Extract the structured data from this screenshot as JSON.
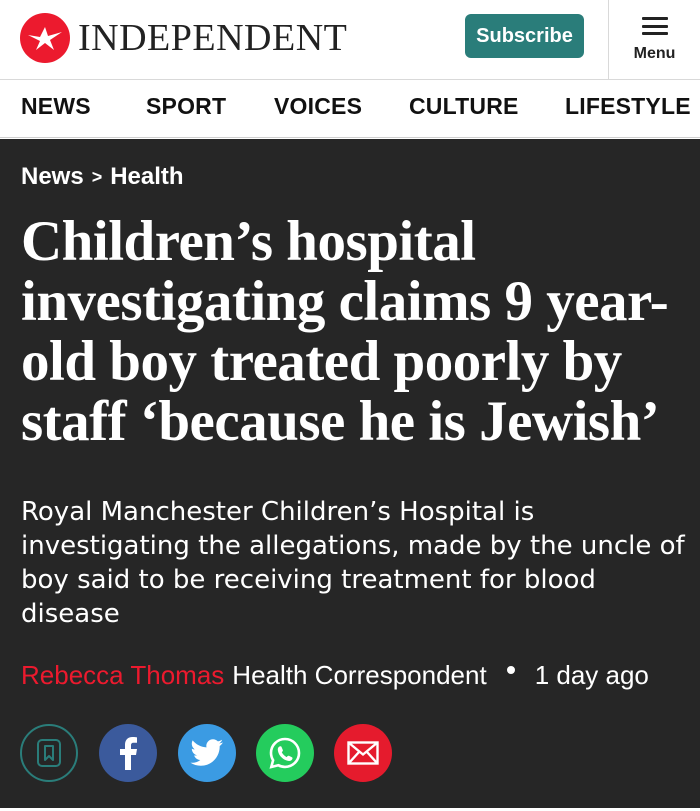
{
  "header": {
    "brand": "INDEPENDENT",
    "subscribe_label": "Subscribe",
    "menu_label": "Menu"
  },
  "nav": {
    "items": [
      {
        "label": "NEWS"
      },
      {
        "label": "SPORT"
      },
      {
        "label": "VOICES"
      },
      {
        "label": "CULTURE"
      },
      {
        "label": "LIFESTYLE"
      }
    ]
  },
  "article": {
    "breadcrumb": {
      "section": "News",
      "separator": ">",
      "subsection": "Health"
    },
    "headline": "Children’s hospital investigating claims 9 year-old boy treated poorly by staff ‘because he is Jewish’",
    "standfirst": "Royal Manchester Children’s Hospital is investigating the allegations, made by the uncle of boy said to be receiving treatment for blood disease",
    "byline": {
      "author": "Rebecca Thomas",
      "role": "Health Correspondent",
      "time": "1 day ago"
    },
    "share_icons": [
      "bookmark-icon",
      "facebook-icon",
      "twitter-icon",
      "whatsapp-icon",
      "email-icon"
    ]
  },
  "colors": {
    "brand_red": "#ec1a2e",
    "subscribe_teal": "#2a7d7a",
    "article_bg": "#262626",
    "facebook": "#3b5a9c",
    "twitter": "#3b9be3",
    "whatsapp": "#24cc5d",
    "email": "#e51b2d"
  }
}
